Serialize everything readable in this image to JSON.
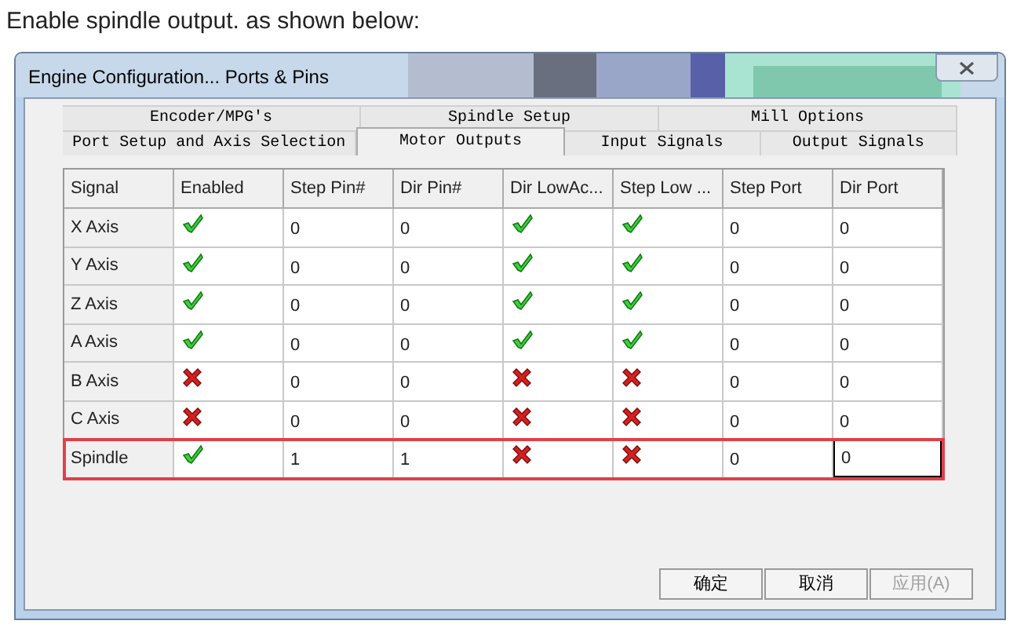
{
  "caption": "Enable spindle output. as shown below:",
  "window": {
    "title": "Engine Configuration... Ports & Pins"
  },
  "tabs": [
    [
      {
        "label": "Encoder/MPG's",
        "selected": false
      },
      {
        "label": "Spindle Setup",
        "selected": false
      },
      {
        "label": "Mill Options",
        "selected": false
      }
    ],
    [
      {
        "label": "Port Setup and Axis Selection",
        "selected": false
      },
      {
        "label": "Motor Outputs",
        "selected": true
      },
      {
        "label": "Input Signals",
        "selected": false
      },
      {
        "label": "Output Signals",
        "selected": false
      }
    ]
  ],
  "table": {
    "columns": [
      "Signal",
      "Enabled",
      "Step Pin#",
      "Dir Pin#",
      "Dir LowAc...",
      "Step Low ...",
      "Step Port",
      "Dir Port"
    ],
    "rows": [
      {
        "signal": "X Axis",
        "enabled": true,
        "step_pin": "0",
        "dir_pin": "0",
        "dir_low_active": true,
        "step_low_active": true,
        "step_port": "0",
        "dir_port": "0",
        "highlighted": false,
        "editing": false
      },
      {
        "signal": "Y Axis",
        "enabled": true,
        "step_pin": "0",
        "dir_pin": "0",
        "dir_low_active": true,
        "step_low_active": true,
        "step_port": "0",
        "dir_port": "0",
        "highlighted": false,
        "editing": false
      },
      {
        "signal": "Z Axis",
        "enabled": true,
        "step_pin": "0",
        "dir_pin": "0",
        "dir_low_active": true,
        "step_low_active": true,
        "step_port": "0",
        "dir_port": "0",
        "highlighted": false,
        "editing": false
      },
      {
        "signal": "A Axis",
        "enabled": true,
        "step_pin": "0",
        "dir_pin": "0",
        "dir_low_active": true,
        "step_low_active": true,
        "step_port": "0",
        "dir_port": "0",
        "highlighted": false,
        "editing": false
      },
      {
        "signal": "B Axis",
        "enabled": false,
        "step_pin": "0",
        "dir_pin": "0",
        "dir_low_active": false,
        "step_low_active": false,
        "step_port": "0",
        "dir_port": "0",
        "highlighted": false,
        "editing": false
      },
      {
        "signal": "C Axis",
        "enabled": false,
        "step_pin": "0",
        "dir_pin": "0",
        "dir_low_active": false,
        "step_low_active": false,
        "step_port": "0",
        "dir_port": "0",
        "highlighted": false,
        "editing": false
      },
      {
        "signal": "Spindle",
        "enabled": true,
        "step_pin": "1",
        "dir_pin": "1",
        "dir_low_active": false,
        "step_low_active": false,
        "step_port": "0",
        "dir_port": "0",
        "highlighted": true,
        "editing": true
      }
    ]
  },
  "buttons": [
    {
      "label": "确定",
      "disabled": false
    },
    {
      "label": "取消",
      "disabled": false
    },
    {
      "label": "应用(A)",
      "disabled": true
    }
  ]
}
